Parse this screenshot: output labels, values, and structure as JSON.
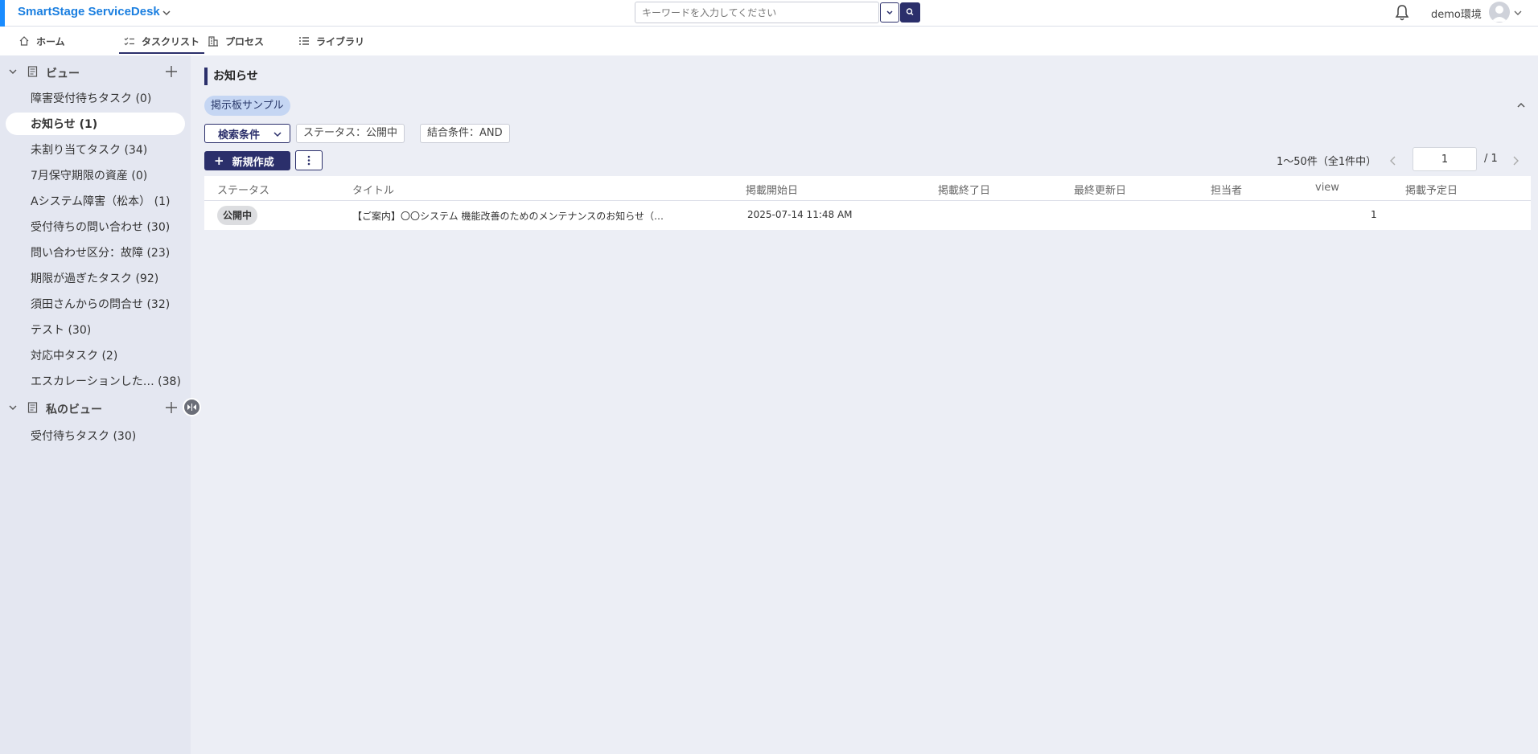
{
  "header": {
    "brand": "SmartStage ServiceDesk",
    "search_placeholder": "キーワードを入力してください",
    "environment": "demo環境"
  },
  "tabs": [
    {
      "label": "ホーム",
      "icon": "home-icon"
    },
    {
      "label": "タスクリスト",
      "icon": "checklist-icon",
      "active": true
    },
    {
      "label": "プロセス",
      "icon": "building-icon"
    },
    {
      "label": "ライブラリ",
      "icon": "list-icon"
    }
  ],
  "sidebar": {
    "views_header": "ビュー",
    "views": [
      "障害受付待ちタスク (0)",
      "お知らせ (1)",
      "未割り当てタスク (34)",
      "7月保守期限の資産 (0)",
      "Aシステム障害（松本） (1)",
      "受付待ちの問い合わせ (30)",
      "問い合わせ区分：故障 (23)",
      "期限が過ぎたタスク (92)",
      "須田さんからの問合せ (32)",
      "テスト (30)",
      "対応中タスク (2)",
      "エスカレーションした… (38)"
    ],
    "active_index": 1,
    "my_views_header": "私のビュー",
    "my_views": [
      "受付待ちタスク (30)"
    ]
  },
  "main": {
    "title": "お知らせ",
    "board_chip": "掲示板サンプル",
    "filter_button": "検索条件",
    "filter_tags": [
      "ステータス：公開中",
      "結合条件：AND"
    ],
    "new_button": "新規作成",
    "pager": {
      "summary": "1〜50件（全1件中）",
      "page": "1",
      "total": "/ 1"
    },
    "columns": [
      "ステータス",
      "タイトル",
      "掲載開始日",
      "掲載終了日",
      "最終更新日",
      "担当者",
      "view",
      "掲載予定日"
    ],
    "rows": [
      {
        "status": "公開中",
        "title": "【ご案内】〇〇システム 機能改善のためのメンテナンスのお知らせ（…",
        "start": "2025-07-14 11:48 AM",
        "end": "",
        "updated": "",
        "owner": "",
        "view": "1",
        "scheduled": ""
      }
    ]
  },
  "colors": {
    "accent": "#2b2f6b",
    "brand": "#1b7fe0",
    "chip": "#c5d6f3",
    "sidebar_bg": "#e4e7f1"
  }
}
